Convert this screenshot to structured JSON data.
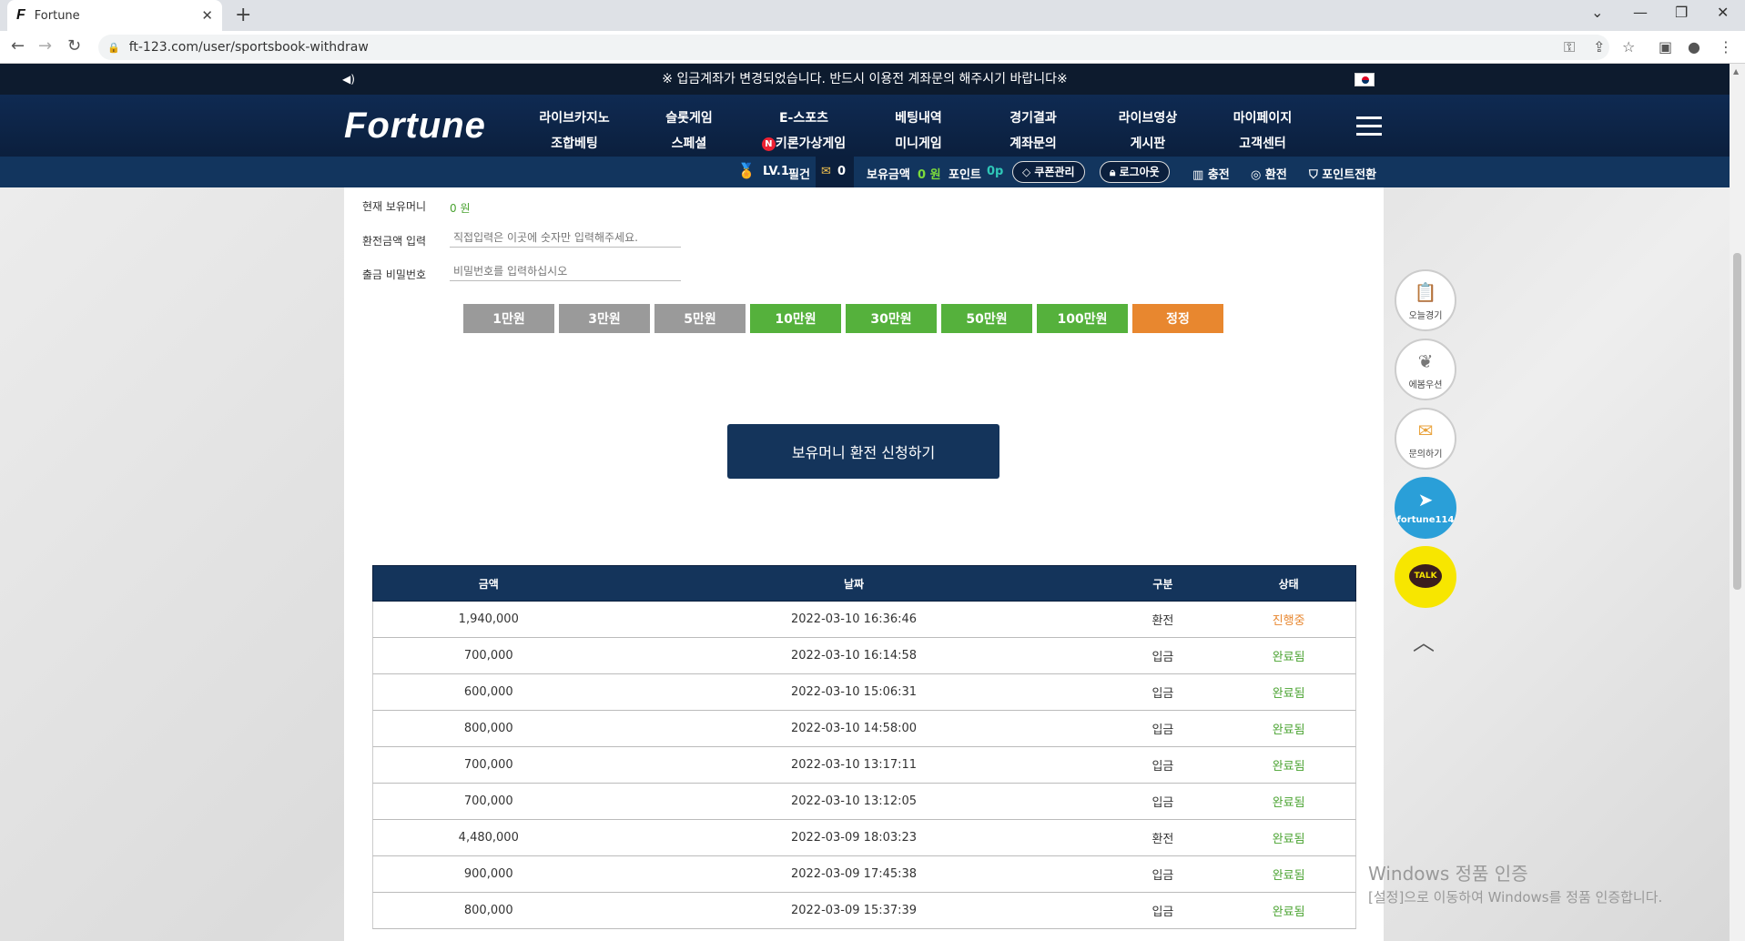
{
  "browser": {
    "tab_title": "Fortune",
    "favicon": "F",
    "url": "ft-123.com/user/sportsbook-withdraw"
  },
  "notice": {
    "text": "※ 입금계좌가 변경되었습니다. 반드시 이용전 계좌문의 해주시기 바랍니다※"
  },
  "header": {
    "logo": "Fortune",
    "menu": [
      {
        "top": "라이브카지노",
        "bottom": "조합베팅"
      },
      {
        "top": "슬롯게임",
        "bottom": "스페셜"
      },
      {
        "top": "E-스포츠",
        "bottom": "키론가상게임",
        "badge": "N"
      },
      {
        "top": "베팅내역",
        "bottom": "미니게임"
      },
      {
        "top": "경기결과",
        "bottom": "계좌문의"
      },
      {
        "top": "라이브영상",
        "bottom": "게시판"
      },
      {
        "top": "마이페이지",
        "bottom": "고객센터"
      }
    ]
  },
  "userbar": {
    "level": "LV.1",
    "username": "필건",
    "messages": "0",
    "balance_label": "보유금액",
    "balance_value": "0 원",
    "point_label": "포인트",
    "point_value": "0p",
    "coupon": "쿠폰관리",
    "logout": "로그아웃",
    "deposit": "충전",
    "withdraw": "환전",
    "point_convert": "포인트전환"
  },
  "form": {
    "current_money_label": "현재 보유머니",
    "current_money_value": "0 원",
    "amount_label": "환전금액 입력",
    "amount_placeholder": "직접입력은 이곳에 숫자만 입력해주세요.",
    "password_label": "출금 비밀번호",
    "password_placeholder": "비밀번호를 입력하십시오",
    "amount_buttons": [
      "1만원",
      "3만원",
      "5만원",
      "10만원",
      "30만원",
      "50만원",
      "100만원"
    ],
    "reset_button": "정정",
    "submit": "보유머니 환전 신청하기"
  },
  "table": {
    "headers": [
      "금액",
      "날짜",
      "구분",
      "상태"
    ],
    "rows": [
      {
        "amount": "1,940,000",
        "date": "2022-03-10 16:36:46",
        "type": "환전",
        "status": "진행중"
      },
      {
        "amount": "700,000",
        "date": "2022-03-10 16:14:58",
        "type": "입금",
        "status": "완료됨"
      },
      {
        "amount": "600,000",
        "date": "2022-03-10 15:06:31",
        "type": "입금",
        "status": "완료됨"
      },
      {
        "amount": "800,000",
        "date": "2022-03-10 14:58:00",
        "type": "입금",
        "status": "완료됨"
      },
      {
        "amount": "700,000",
        "date": "2022-03-10 13:17:11",
        "type": "입금",
        "status": "완료됨"
      },
      {
        "amount": "700,000",
        "date": "2022-03-10 13:12:05",
        "type": "입금",
        "status": "완료됨"
      },
      {
        "amount": "4,480,000",
        "date": "2022-03-09 18:03:23",
        "type": "환전",
        "status": "완료됨"
      },
      {
        "amount": "900,000",
        "date": "2022-03-09 17:45:38",
        "type": "입금",
        "status": "완료됨"
      },
      {
        "amount": "800,000",
        "date": "2022-03-09 15:37:39",
        "type": "입금",
        "status": "완료됨"
      }
    ]
  },
  "side": {
    "today": "오늘경기",
    "ebom": "에봄우션",
    "inquiry": "문의하기",
    "telegram": "fortune114",
    "talk": "TALK"
  },
  "watermark": {
    "line1": "Windows 정품 인증",
    "line2": "[설정]으로 이동하여 Windows를 정품 인증합니다."
  }
}
